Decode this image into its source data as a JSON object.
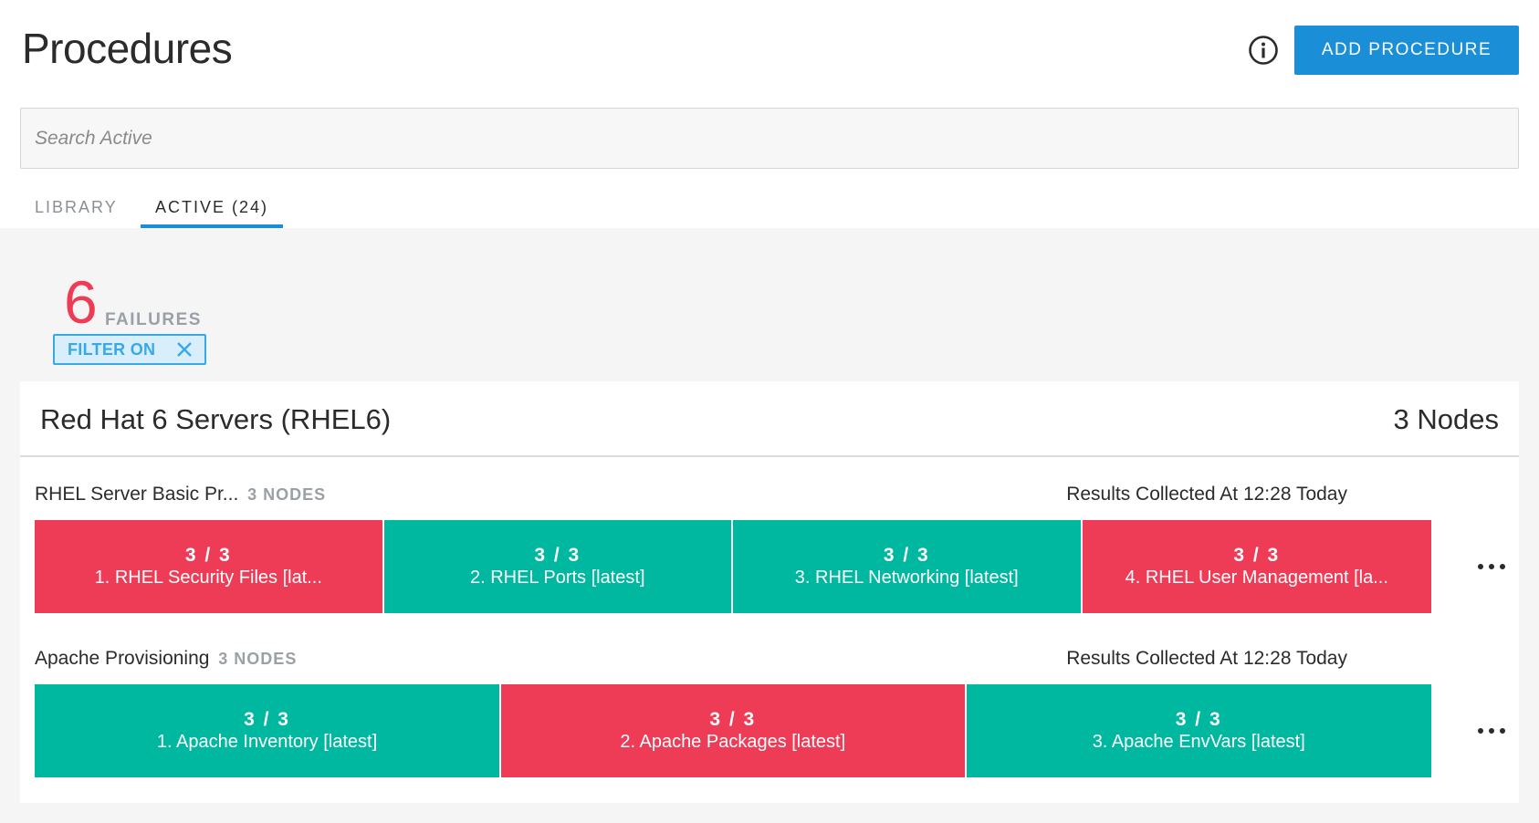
{
  "header": {
    "title": "Procedures",
    "add_button_label": "ADD PROCEDURE"
  },
  "search": {
    "placeholder": "Search Active",
    "value": ""
  },
  "tabs": [
    {
      "label": "LIBRARY",
      "active": false
    },
    {
      "label": "ACTIVE (24)",
      "active": true
    }
  ],
  "failures": {
    "count": "6",
    "label": "FAILURES",
    "filter_label": "FILTER ON"
  },
  "group": {
    "title": "Red Hat 6 Servers (RHEL6)",
    "nodes": "3 Nodes",
    "procedures": [
      {
        "name": "RHEL Server Basic Pr...",
        "nodes": "3 NODES",
        "results": "Results Collected At 12:28 Today",
        "steps": [
          {
            "count": "3 / 3",
            "label": "1. RHEL Security Files [lat...",
            "status": "fail"
          },
          {
            "count": "3 / 3",
            "label": "2. RHEL Ports [latest]",
            "status": "pass"
          },
          {
            "count": "3 / 3",
            "label": "3. RHEL Networking [latest]",
            "status": "pass"
          },
          {
            "count": "3 / 3",
            "label": "4. RHEL User Management [la...",
            "status": "fail"
          }
        ]
      },
      {
        "name": "Apache Provisioning",
        "nodes": "3 NODES",
        "results": "Results Collected At 12:28 Today",
        "steps": [
          {
            "count": "3 / 3",
            "label": "1. Apache Inventory [latest]",
            "status": "pass"
          },
          {
            "count": "3 / 3",
            "label": "2. Apache Packages [latest]",
            "status": "fail"
          },
          {
            "count": "3 / 3",
            "label": "3. Apache EnvVars [latest]",
            "status": "pass"
          }
        ]
      }
    ]
  },
  "icons": {
    "info": "info-icon",
    "close": "close-icon",
    "more": "more-icon"
  },
  "colors": {
    "accent": "#1a8fd8",
    "fail": "#ee3b56",
    "pass": "#00b8a0",
    "filter": "#37a9e8"
  }
}
